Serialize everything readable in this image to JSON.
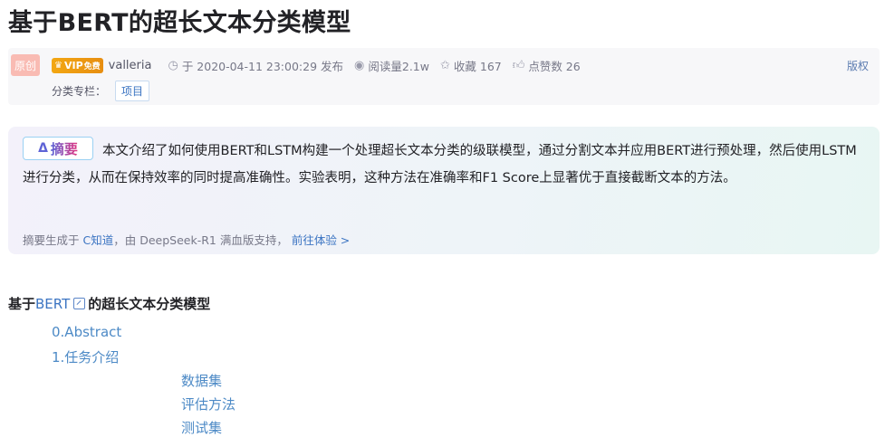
{
  "article": {
    "title": "基于BERT的超长文本分类模型"
  },
  "meta": {
    "original_label": "原创",
    "vip": {
      "label": "VIP",
      "free_label": "免费"
    },
    "author": "valleria",
    "publish": "于 2020-04-11 23:00:29 发布",
    "reads": "阅读量2.1w",
    "favorites": "收藏 167",
    "likes": "点赞数 26",
    "copyright": "版权",
    "category_label": "分类专栏：",
    "category_tag": "项目",
    "icons": [
      "clock-icon",
      "eye-icon",
      "star-icon",
      "thumbs-up-icon",
      "crown-icon"
    ]
  },
  "summary": {
    "badge": "摘要",
    "text": "本文介绍了如何使用BERT和LSTM构建一个处理超长文本分类的级联模型，通过分割文本并应用BERT进行预处理，然后使用LSTM进行分类，从而在保持效率的同时提高准确性。实验表明，这种方法在准确率和F1 Score上显著优于直接截断文本的方法。",
    "foot_prefix": "摘要生成于",
    "foot_source": "C知道",
    "foot_middle": "，由 DeepSeek-R1 满血版支持，",
    "foot_link": "前往体验 >"
  },
  "toc": {
    "heading_prefix": "基于",
    "heading_keyword": "BERT",
    "heading_suffix": "的超长文本分类模型",
    "items": [
      "0.Abstract",
      "1.任务介绍",
      "数据集",
      "评估方法",
      "测试集"
    ]
  },
  "colors": {
    "accent_link": "#3b74c2",
    "toc_link": "#4d8ac6",
    "original_badge": "#f9bbb3",
    "vip_gold": "#f3a712"
  }
}
